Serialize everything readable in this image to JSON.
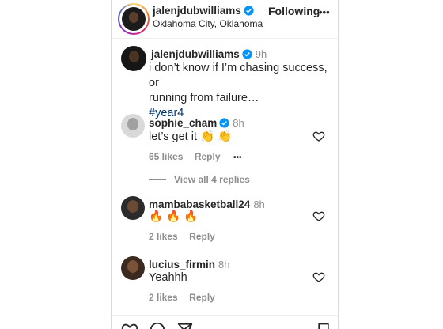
{
  "header": {
    "username": "jalenjdubwilliams",
    "location": "Oklahoma City, Oklahoma",
    "follow_label": "Following",
    "more_label": "•••"
  },
  "caption": {
    "username": "jalenjdubwilliams",
    "time": "9h",
    "line1": "i don’t know if I’m chasing success, or",
    "line2": "running from failure…",
    "hashtag": "#year4"
  },
  "comments": [
    {
      "username": "sophie_cham",
      "time": "8h",
      "text": "let’s get it 👏 👏",
      "likes": "65 likes",
      "reply": "Reply",
      "more": "•••"
    },
    {
      "username": "mambabasketball24",
      "time": "8h",
      "text": "🔥 🔥 🔥",
      "likes": "2 likes",
      "reply": "Reply"
    },
    {
      "username": "lucius_firmin",
      "time": "8h",
      "text": "Yeahhh",
      "likes": "2 likes",
      "reply": "Reply"
    }
  ],
  "view_replies": "View all 4 replies",
  "colors": {
    "verified": "#0095f6",
    "hashtag": "#00376b",
    "secondary": "#8e8e8e"
  }
}
